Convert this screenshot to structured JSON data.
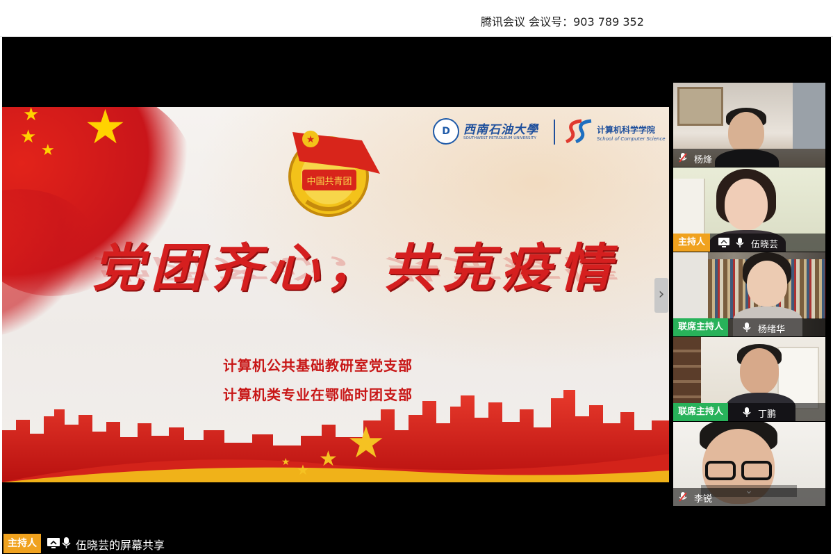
{
  "titlebar": {
    "title": "腾讯会议 会议号：903 789 352"
  },
  "slide": {
    "university_logo_text": "西南石油大學",
    "university_logo_en": "SOUTHWEST PETROLEUM UNIVERSITY",
    "college_name": "计算机科学学院",
    "college_name_en": "School of Computer Science",
    "emblem_text": "中国共青团",
    "headline": "党团齐心，共克疫情",
    "subtitle_1": "计算机公共基础教研室党支部",
    "subtitle_2": "计算机类专业在鄂临时团支部",
    "colors": {
      "red": "#d51f1f",
      "gold": "#ffd200"
    }
  },
  "participants": [
    {
      "name": "杨烽",
      "role": "",
      "mic": "muted"
    },
    {
      "name": "伍晓芸",
      "role": "主持人",
      "mic": "on",
      "sharing": true
    },
    {
      "name": "杨绪华",
      "role": "联席主持人",
      "mic": "on"
    },
    {
      "name": "丁鹏",
      "role": "联席主持人",
      "mic": "on"
    },
    {
      "name": "李锐",
      "role": "",
      "mic": "muted"
    }
  ],
  "bottom_bar": {
    "role": "主持人",
    "share_label": "伍晓芸的屏幕共享"
  },
  "icons": {
    "next": "chevron-right-icon",
    "expand": "chevron-down-icon"
  },
  "chevron_right_glyph": "›",
  "chevron_down_glyph": "⌄"
}
